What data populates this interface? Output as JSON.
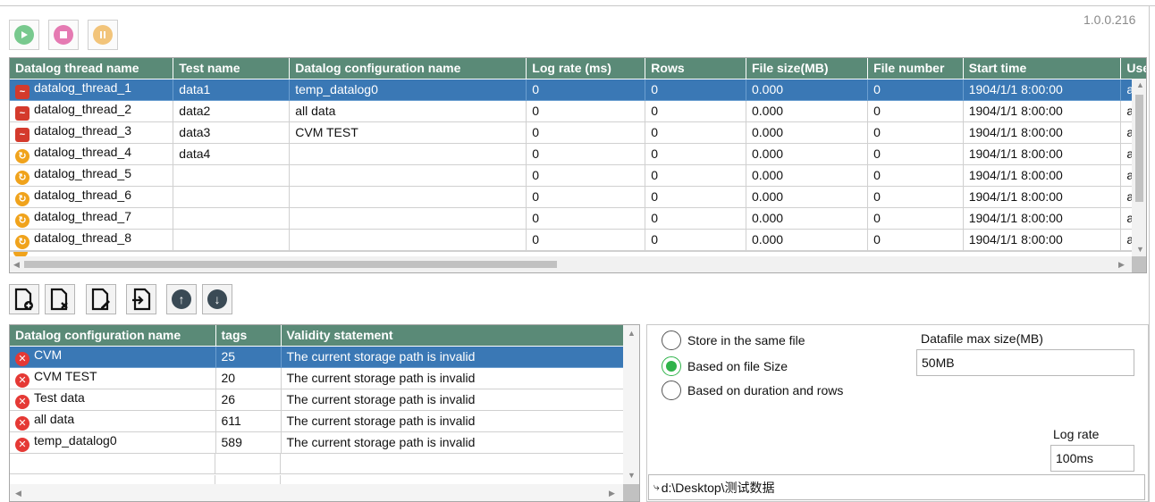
{
  "version": "1.0.0.216",
  "colors": {
    "header_bg": "#5a8a77",
    "selection_bg": "#3a78b5",
    "radio_checked": "#2fb34a"
  },
  "toolbar_top": {
    "play": {
      "icon": "play-icon",
      "color": "#78c98e"
    },
    "stop": {
      "icon": "stop-icon",
      "color": "#e57ab2"
    },
    "pause": {
      "icon": "pause-icon",
      "color": "#f2c47a"
    }
  },
  "thread_table": {
    "columns": [
      "Datalog thread name",
      "Test name",
      "Datalog configuration name",
      "Log rate (ms)",
      "Rows",
      "File size(MB)",
      "File number",
      "Start time",
      "Use"
    ],
    "rows": [
      {
        "icon": "red",
        "name": "datalog_thread_1",
        "test": "data1",
        "config": "temp_datalog0",
        "rate": "0",
        "rows": "0",
        "size": "0.000",
        "filenum": "0",
        "start": "1904/1/1 8:00:00",
        "user": "adr",
        "selected": true
      },
      {
        "icon": "red",
        "name": "datalog_thread_2",
        "test": "data2",
        "config": "all data",
        "rate": "0",
        "rows": "0",
        "size": "0.000",
        "filenum": "0",
        "start": "1904/1/1 8:00:00",
        "user": "adr"
      },
      {
        "icon": "red",
        "name": "datalog_thread_3",
        "test": "data3",
        "config": "CVM TEST",
        "rate": "0",
        "rows": "0",
        "size": "0.000",
        "filenum": "0",
        "start": "1904/1/1 8:00:00",
        "user": "adr"
      },
      {
        "icon": "orange",
        "name": "datalog_thread_4",
        "test": "data4",
        "config": "",
        "rate": "0",
        "rows": "0",
        "size": "0.000",
        "filenum": "0",
        "start": "1904/1/1 8:00:00",
        "user": "adr"
      },
      {
        "icon": "orange",
        "name": "datalog_thread_5",
        "test": "",
        "config": "",
        "rate": "0",
        "rows": "0",
        "size": "0.000",
        "filenum": "0",
        "start": "1904/1/1 8:00:00",
        "user": "adr"
      },
      {
        "icon": "orange",
        "name": "datalog_thread_6",
        "test": "",
        "config": "",
        "rate": "0",
        "rows": "0",
        "size": "0.000",
        "filenum": "0",
        "start": "1904/1/1 8:00:00",
        "user": "adr"
      },
      {
        "icon": "orange",
        "name": "datalog_thread_7",
        "test": "",
        "config": "",
        "rate": "0",
        "rows": "0",
        "size": "0.000",
        "filenum": "0",
        "start": "1904/1/1 8:00:00",
        "user": "adr"
      },
      {
        "icon": "orange",
        "name": "datalog_thread_8",
        "test": "",
        "config": "",
        "rate": "0",
        "rows": "0",
        "size": "0.000",
        "filenum": "0",
        "start": "1904/1/1 8:00:00",
        "user": "adr"
      }
    ]
  },
  "toolbar_mid": [
    {
      "name": "new-config-button",
      "icon": "file-add-icon"
    },
    {
      "name": "delete-config-button",
      "icon": "file-delete-icon"
    },
    {
      "name": "edit-config-button",
      "icon": "file-edit-icon"
    },
    {
      "name": "import-config-button",
      "icon": "file-import-icon"
    },
    {
      "name": "move-up-button",
      "icon": "arrow-up-icon",
      "glyph": "↑"
    },
    {
      "name": "move-down-button",
      "icon": "arrow-down-icon",
      "glyph": "↓"
    }
  ],
  "config_table": {
    "columns": [
      "Datalog configuration name",
      "tags",
      "Validity statement"
    ],
    "rows": [
      {
        "name": "CVM",
        "tags": "25",
        "validity": "The current storage path is invalid",
        "selected": true
      },
      {
        "name": "CVM TEST",
        "tags": "20",
        "validity": "The current storage path is invalid"
      },
      {
        "name": "Test data",
        "tags": "26",
        "validity": "The current storage path is invalid"
      },
      {
        "name": "all data",
        "tags": "611",
        "validity": "The current storage path is invalid"
      },
      {
        "name": "temp_datalog0",
        "tags": "589",
        "validity": "The current storage path is invalid"
      }
    ]
  },
  "settings": {
    "radio_options": [
      {
        "label": "Store in the same file",
        "checked": false
      },
      {
        "label": "Based on file Size",
        "checked": true
      },
      {
        "label": "Based on duration and rows",
        "checked": false
      }
    ],
    "max_size_label": "Datafile max size(MB)",
    "max_size_value": "50MB",
    "log_rate_label": "Log rate",
    "log_rate_value": "100ms",
    "path": "d:\\Desktop\\测试数据"
  }
}
